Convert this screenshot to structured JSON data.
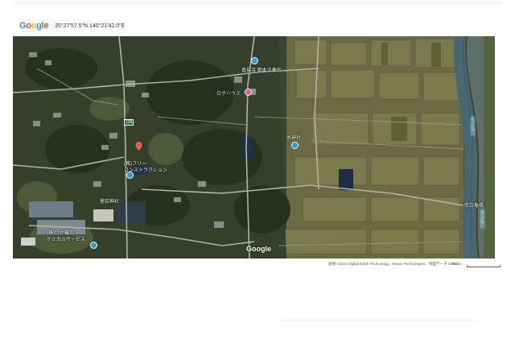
{
  "header": {
    "logo": "Google",
    "coordinates": "35°27'57.5\"N 140°21'42.0\"E"
  },
  "map": {
    "labels": {
      "temple": "真福寺 御本法華宗",
      "shiroko": "白子ハウス",
      "route": "128",
      "suijin": "水神社",
      "company_line1": "(株)フリー",
      "company_line2": "コンストラクション",
      "shrine": "愛宕神社",
      "factory_line1": "(株)つか機工",
      "factory_line2": "ケミカルサービス",
      "bridge": "南白亀橋",
      "river1": "南白亀川",
      "river2": "南白亀川",
      "watermark": "Google"
    },
    "colors": {
      "fields": "#6f6f45",
      "forest": "#2e3a25",
      "river": "#4e6b73",
      "road": "#b8b4a8",
      "pin": "#ea6a3c"
    }
  },
  "footer": {
    "attribution": "画像 ©2021 Digital Earth Technology、Maxar Technologies、地図データ ©2021",
    "scale": "100 m"
  }
}
